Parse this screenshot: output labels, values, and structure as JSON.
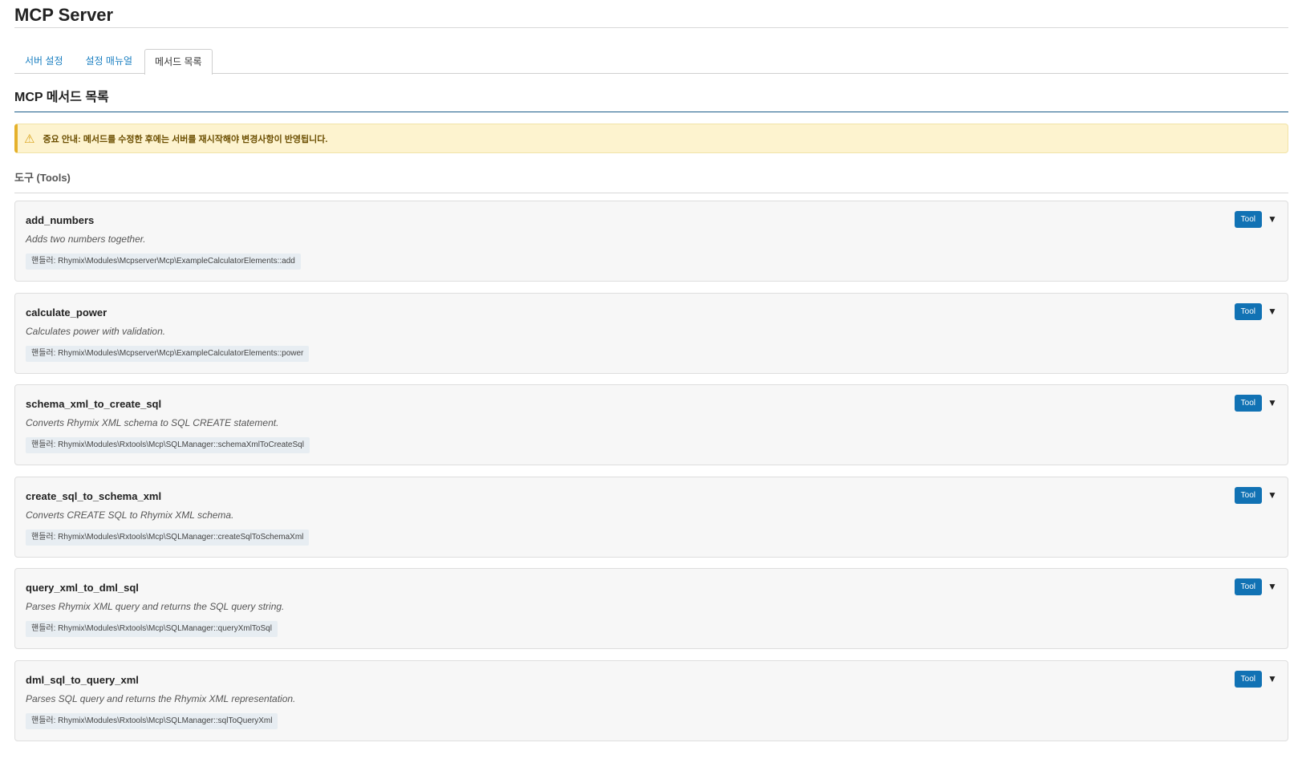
{
  "page": {
    "title": "MCP Server"
  },
  "tabs": [
    {
      "label": "서버 설정",
      "active": false
    },
    {
      "label": "설정 매뉴얼",
      "active": false
    },
    {
      "label": "메서드 목록",
      "active": true
    }
  ],
  "section": {
    "title": "MCP 메서드 목록"
  },
  "notice": {
    "icon": "warning-icon",
    "text": "중요 안내: 메서드를 수정한 후에는 서버를 재시작해야 변경사항이 반영됩니다."
  },
  "tools_group": {
    "title": "도구 (Tools)"
  },
  "tools": [
    {
      "name": "add_numbers",
      "description": "Adds two numbers together.",
      "handler": "핸들러: Rhymix\\Modules\\Mcpserver\\Mcp\\ExampleCalculatorElements::add",
      "badge": "Tool",
      "toggle": "▼"
    },
    {
      "name": "calculate_power",
      "description": "Calculates power with validation.",
      "handler": "핸들러: Rhymix\\Modules\\Mcpserver\\Mcp\\ExampleCalculatorElements::power",
      "badge": "Tool",
      "toggle": "▼"
    },
    {
      "name": "schema_xml_to_create_sql",
      "description": "Converts Rhymix XML schema to SQL CREATE statement.",
      "handler": "핸들러: Rhymix\\Modules\\Rxtools\\Mcp\\SQLManager::schemaXmlToCreateSql",
      "badge": "Tool",
      "toggle": "▼"
    },
    {
      "name": "create_sql_to_schema_xml",
      "description": "Converts CREATE SQL to Rhymix XML schema.",
      "handler": "핸들러: Rhymix\\Modules\\Rxtools\\Mcp\\SQLManager::createSqlToSchemaXml",
      "badge": "Tool",
      "toggle": "▼"
    },
    {
      "name": "query_xml_to_dml_sql",
      "description": "Parses Rhymix XML query and returns the SQL query string.",
      "handler": "핸들러: Rhymix\\Modules\\Rxtools\\Mcp\\SQLManager::queryXmlToSql",
      "badge": "Tool",
      "toggle": "▼"
    },
    {
      "name": "dml_sql_to_query_xml",
      "description": "Parses SQL query and returns the Rhymix XML representation.",
      "handler": "핸들러: Rhymix\\Modules\\Rxtools\\Mcp\\SQLManager::sqlToQueryXml",
      "badge": "Tool",
      "toggle": "▼"
    }
  ]
}
